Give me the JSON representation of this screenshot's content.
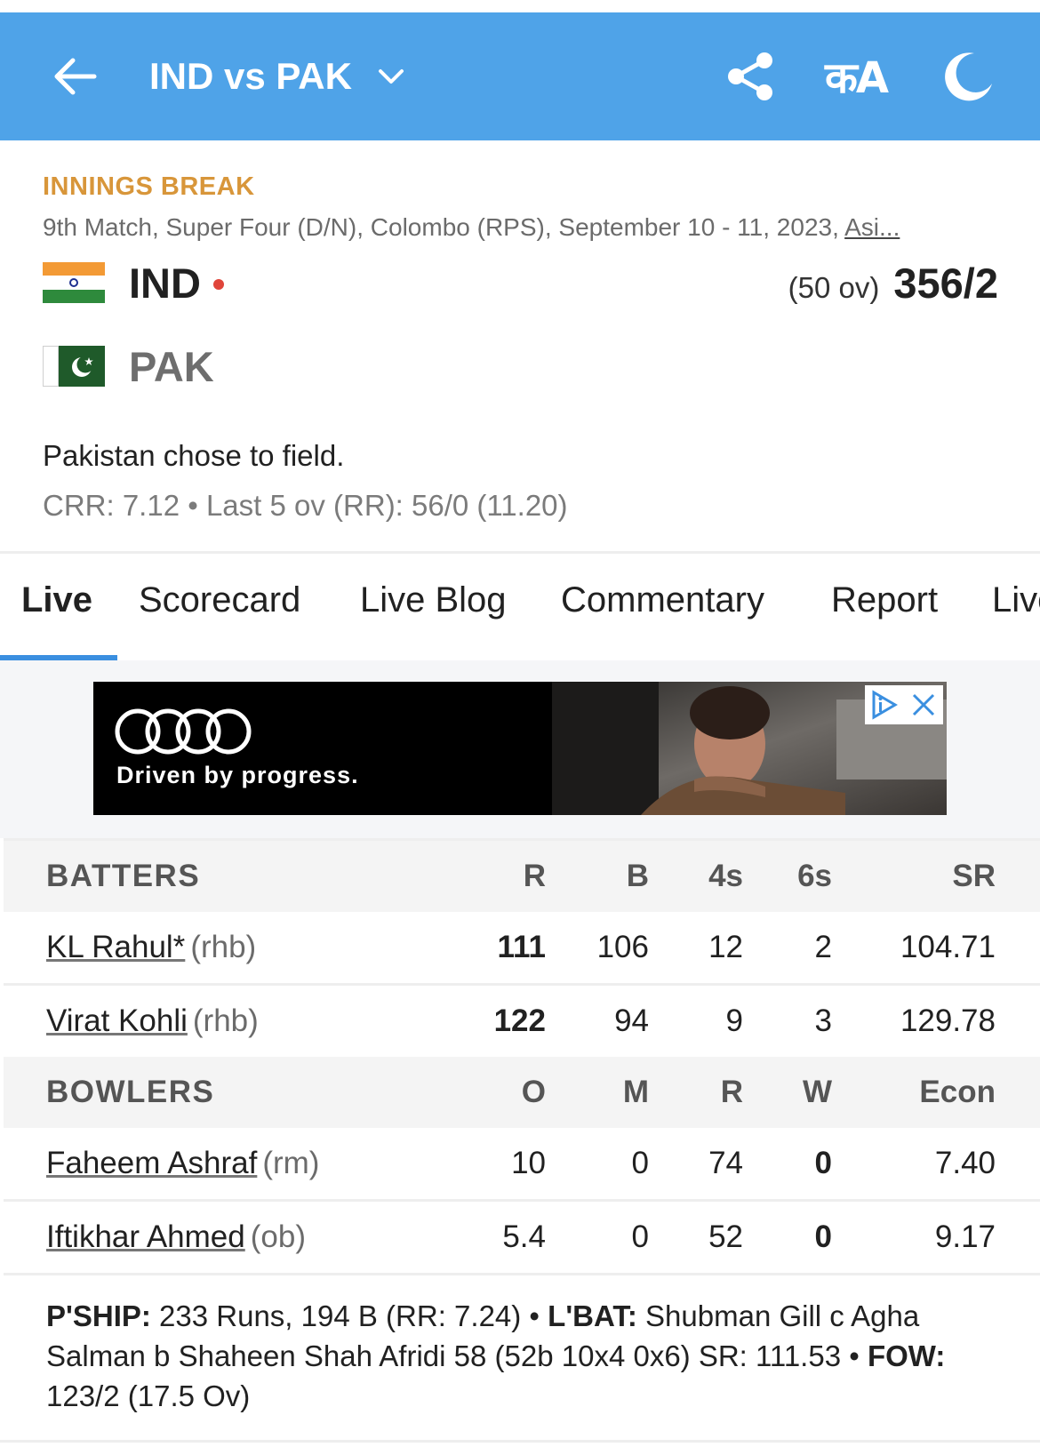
{
  "header": {
    "title": "IND vs PAK",
    "lang_label": "कA",
    "bar_color": "#4fa3e8"
  },
  "match": {
    "status": "INNINGS BREAK",
    "info": "9th Match, Super Four (D/N), Colombo (RPS), September 10 - 11, 2023, ",
    "info_link": "Asi...",
    "status_color": "#d8963a"
  },
  "teams": [
    {
      "name": "IND",
      "overs": "(50 ov)",
      "score": "356/2",
      "batting": true
    },
    {
      "name": "PAK",
      "overs": "",
      "score": "",
      "batting": false
    }
  ],
  "toss": "Pakistan chose to field.",
  "rates": "CRR: 7.12 • Last 5 ov (RR): 56/0 (11.20)",
  "tabs": [
    "Live",
    "Scorecard",
    "Live Blog",
    "Commentary",
    "Report",
    "Live"
  ],
  "active_tab": "Live",
  "ad": {
    "slogan": "Driven by progress."
  },
  "batters": {
    "header": [
      "BATTERS",
      "R",
      "B",
      "4s",
      "6s",
      "SR"
    ],
    "rows": [
      {
        "name": "KL Rahul*",
        "style": "(rhb)",
        "R": "111",
        "B": "106",
        "4s": "12",
        "6s": "2",
        "SR": "104.71"
      },
      {
        "name": "Virat Kohli",
        "style": "(rhb)",
        "R": "122",
        "B": "94",
        "4s": "9",
        "6s": "3",
        "SR": "129.78"
      }
    ]
  },
  "bowlers": {
    "header": [
      "BOWLERS",
      "O",
      "M",
      "R",
      "W",
      "Econ"
    ],
    "rows": [
      {
        "name": "Faheem Ashraf",
        "style": "(rm)",
        "O": "10",
        "M": "0",
        "R": "74",
        "W": "0",
        "Econ": "7.40"
      },
      {
        "name": "Iftikhar Ahmed",
        "style": "(ob)",
        "O": "5.4",
        "M": "0",
        "R": "52",
        "W": "0",
        "Econ": "9.17"
      }
    ]
  },
  "footer": {
    "pship_label": "P'SHIP:",
    "pship_value": " 233 Runs, 194 B (RR: 7.24) • ",
    "lbat_label": "L'BAT:",
    "lbat_value": " Shubman Gill c Agha Salman b Shaheen Shah Afridi 58 (52b 10x4 0x6) SR: 111.53 • ",
    "fow_label": "FOW:",
    "fow_value": " 123/2 (17.5 Ov)"
  }
}
